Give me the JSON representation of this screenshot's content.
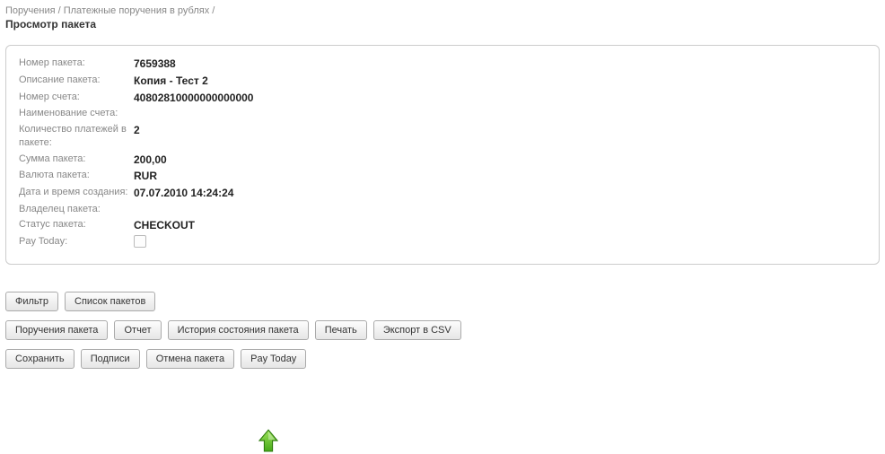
{
  "breadcrumb": {
    "part1": "Поручения",
    "sep1": " / ",
    "part2": "Платежные поручения в рублях",
    "sep2": " /"
  },
  "page_title": "Просмотр пакета",
  "fields": {
    "number_label": "Номер пакета:",
    "number_value": "7659388",
    "desc_label": "Описание пакета:",
    "desc_value": "Копия - Тест 2",
    "account_label": "Номер счета:",
    "account_value": "40802810000000000000",
    "account_name_label": "Наименование счета:",
    "account_name_value": "",
    "count_label": "Количество платежей в пакете:",
    "count_value": "2",
    "sum_label": "Сумма пакета:",
    "sum_value": "200,00",
    "currency_label": "Валюта пакета:",
    "currency_value": "RUR",
    "datetime_label": "Дата и время создания:",
    "datetime_value": "07.07.2010 14:24:24",
    "owner_label": "Владелец пакета:",
    "owner_value": "",
    "status_label": "Статус пакета:",
    "status_value": "CHECKOUT",
    "paytoday_label": "Pay Today:"
  },
  "buttons": {
    "filter": "Фильтр",
    "packet_list": "Список пакетов",
    "packet_orders": "Поручения пакета",
    "report": "Отчет",
    "status_history": "История состояния пакета",
    "print": "Печать",
    "export_csv": "Экспорт в CSV",
    "save": "Сохранить",
    "signatures": "Подписи",
    "cancel_packet": "Отмена пакета",
    "pay_today": "Pay Today"
  }
}
